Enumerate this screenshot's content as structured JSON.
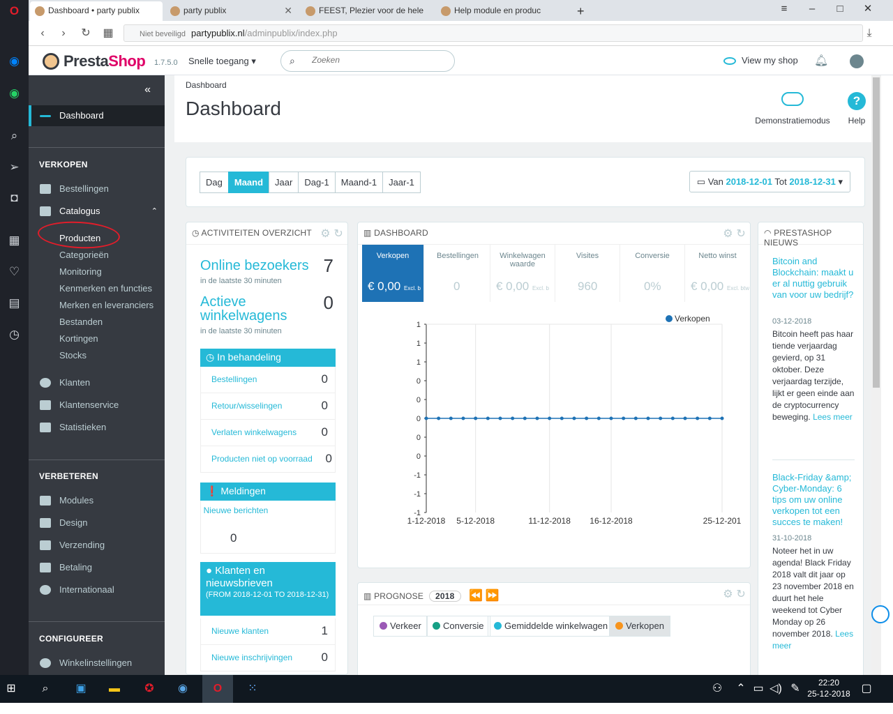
{
  "browser": {
    "tabs": [
      {
        "title": "Dashboard • party publix"
      },
      {
        "title": "party publix"
      },
      {
        "title": "FEEST, Plezier voor de hele"
      },
      {
        "title": "Help module en produc"
      }
    ],
    "security": "Niet beveiligd",
    "url_host": "partypublix.nl",
    "url_path": "/adminpublix/index.php"
  },
  "header": {
    "logo_pre": "Presta",
    "logo_post": "Shop",
    "version": "1.7.5.0",
    "quick_access": "Snelle toegang",
    "search_placeholder": "Zoeken",
    "view_shop": "View my shop"
  },
  "sidebar": {
    "dashboard": "Dashboard",
    "sec_verkopen": "VERKOPEN",
    "bestellingen": "Bestellingen",
    "catalogus": "Catalogus",
    "sub": [
      "Producten",
      "Categorieën",
      "Monitoring",
      "Kenmerken en functies",
      "Merken en leveranciers",
      "Bestanden",
      "Kortingen",
      "Stocks"
    ],
    "klanten": "Klanten",
    "klantenservice": "Klantenservice",
    "statistieken": "Statistieken",
    "sec_verbeteren": "VERBETEREN",
    "modules": "Modules",
    "design": "Design",
    "verzending": "Verzending",
    "betaling": "Betaling",
    "internationaal": "Internationaal",
    "sec_configureer": "CONFIGUREER",
    "winkelinstellingen": "Winkelinstellingen"
  },
  "page": {
    "breadcrumb": "Dashboard",
    "title": "Dashboard",
    "demo": "Demonstratiemodus",
    "help": "Help"
  },
  "date": {
    "buttons": [
      "Dag",
      "Maand",
      "Jaar",
      "Dag-1",
      "Maand-1",
      "Jaar-1"
    ],
    "from_label": "Van",
    "from": "2018-12-01",
    "to_label": "Tot",
    "to": "2018-12-31"
  },
  "activity": {
    "title": "ACTIVITEITEN OVERZICHT",
    "online_label": "Online bezoekers",
    "online_value": "7",
    "online_sub": "in de laatste 30 minuten",
    "carts_label": "Actieve winkelwagens",
    "carts_value": "0",
    "carts_sub": "in de laatste 30 minuten",
    "pending_title": "In behandeling",
    "pending": [
      {
        "label": "Bestellingen",
        "value": "0"
      },
      {
        "label": "Retour/wisselingen",
        "value": "0"
      },
      {
        "label": "Verlaten winkelwagens",
        "value": "0"
      },
      {
        "label": "Producten niet op voorraad",
        "value": "0"
      }
    ],
    "notif_title": "Meldingen",
    "notif_label": "Nieuwe berichten",
    "notif_value": "0",
    "cust_title": "Klanten en nieuwsbrieven",
    "cust_range": "(FROM 2018-12-01 TO 2018-12-31)",
    "cust_rows": [
      {
        "label": "Nieuwe klanten",
        "value": "1"
      },
      {
        "label": "Nieuwe inschrijvingen",
        "value": "0"
      }
    ]
  },
  "dashboard": {
    "title": "DASHBOARD",
    "kpis": [
      {
        "label": "Verkopen",
        "value": "€ 0,00",
        "suffix": "Excl. b"
      },
      {
        "label": "Bestellingen",
        "value": "0",
        "suffix": ""
      },
      {
        "label": "Winkelwagen waarde",
        "value": "€ 0,00",
        "suffix": "Excl. b"
      },
      {
        "label": "Visites",
        "value": "960",
        "suffix": ""
      },
      {
        "label": "Conversie",
        "value": "0%",
        "suffix": ""
      },
      {
        "label": "Netto winst",
        "value": "€ 0,00",
        "suffix": "Excl. btw"
      }
    ],
    "accent": "#1e72b5"
  },
  "chart_data": {
    "type": "line",
    "legend": "Verkopen",
    "legend_position": "top-right",
    "y_tick_labels": [
      "1",
      "1",
      "1",
      "0",
      "0",
      "0",
      "0",
      "0",
      "-1",
      "-1",
      "-1"
    ],
    "x_tick_labels": [
      "1-12-2018",
      "5-12-2018",
      "11-12-2018",
      "16-12-2018",
      "25-12-201"
    ],
    "series": [
      {
        "name": "Verkopen",
        "values": [
          0,
          0,
          0,
          0,
          0,
          0,
          0,
          0,
          0,
          0,
          0,
          0,
          0,
          0,
          0,
          0,
          0,
          0,
          0,
          0,
          0,
          0,
          0,
          0,
          0
        ]
      }
    ],
    "color": "#1e72b5",
    "grid": true
  },
  "prognose": {
    "title": "PROGNOSE",
    "year": "2018",
    "legend": [
      {
        "label": "Verkeer",
        "color": "#9b59b6"
      },
      {
        "label": "Conversie",
        "color": "#16a085"
      },
      {
        "label": "Gemiddelde winkelwagen",
        "color": "#25b9d7"
      },
      {
        "label": "Verkopen",
        "color": "#f7941d"
      }
    ]
  },
  "news": {
    "title": "PRESTASHOP NIEUWS",
    "items": [
      {
        "headline": "Bitcoin and Blockchain: maakt u er al nuttig gebruik van voor uw bedrijf?",
        "date": "03-12-2018",
        "text": "Bitcoin heeft pas haar tiende verjaardag gevierd, op 31 oktober. Deze verjaardag terzijde, lijkt er geen einde aan de cryptocurrency beweging.",
        "more": "Lees meer"
      },
      {
        "headline": "Black-Friday &amp; Cyber-Monday: 6 tips om uw online verkopen tot een succes te maken!",
        "date": "31-10-2018",
        "text": "Noteer het in uw agenda! Black Friday 2018 valt dit jaar op 23 november 2018 en duurt het hele weekend tot Cyber Monday op 26 november 2018.",
        "more": "Lees meer"
      }
    ]
  },
  "taskbar": {
    "time": "22:20",
    "date": "25-12-2018"
  }
}
